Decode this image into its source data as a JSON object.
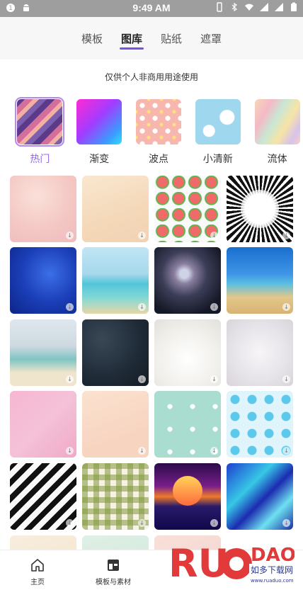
{
  "status_bar": {
    "time": "9:49 AM"
  },
  "header": {
    "tabs": [
      {
        "label": "模板"
      },
      {
        "label": "图库"
      },
      {
        "label": "贴纸"
      },
      {
        "label": "遮罩"
      }
    ],
    "active_tab": "图库",
    "accent_color": "#7b4fe0"
  },
  "notice": "仅供个人非商用用途使用",
  "categories": [
    {
      "label": "热门"
    },
    {
      "label": "渐变"
    },
    {
      "label": "波点"
    },
    {
      "label": "小清新"
    },
    {
      "label": "流体"
    }
  ],
  "active_category": "热门",
  "category_active_color": "#9a63f0",
  "gallery": {
    "download_icon": "download-icon",
    "download_glyph": "↓"
  },
  "bottom_nav": [
    {
      "label": "主页",
      "icon": "home-icon"
    },
    {
      "label": "模板与素材",
      "icon": "templates-icon"
    }
  ],
  "watermark": {
    "brand": "RUANDAO",
    "site": "如多下载网",
    "url": "www.ruaduo.com"
  }
}
